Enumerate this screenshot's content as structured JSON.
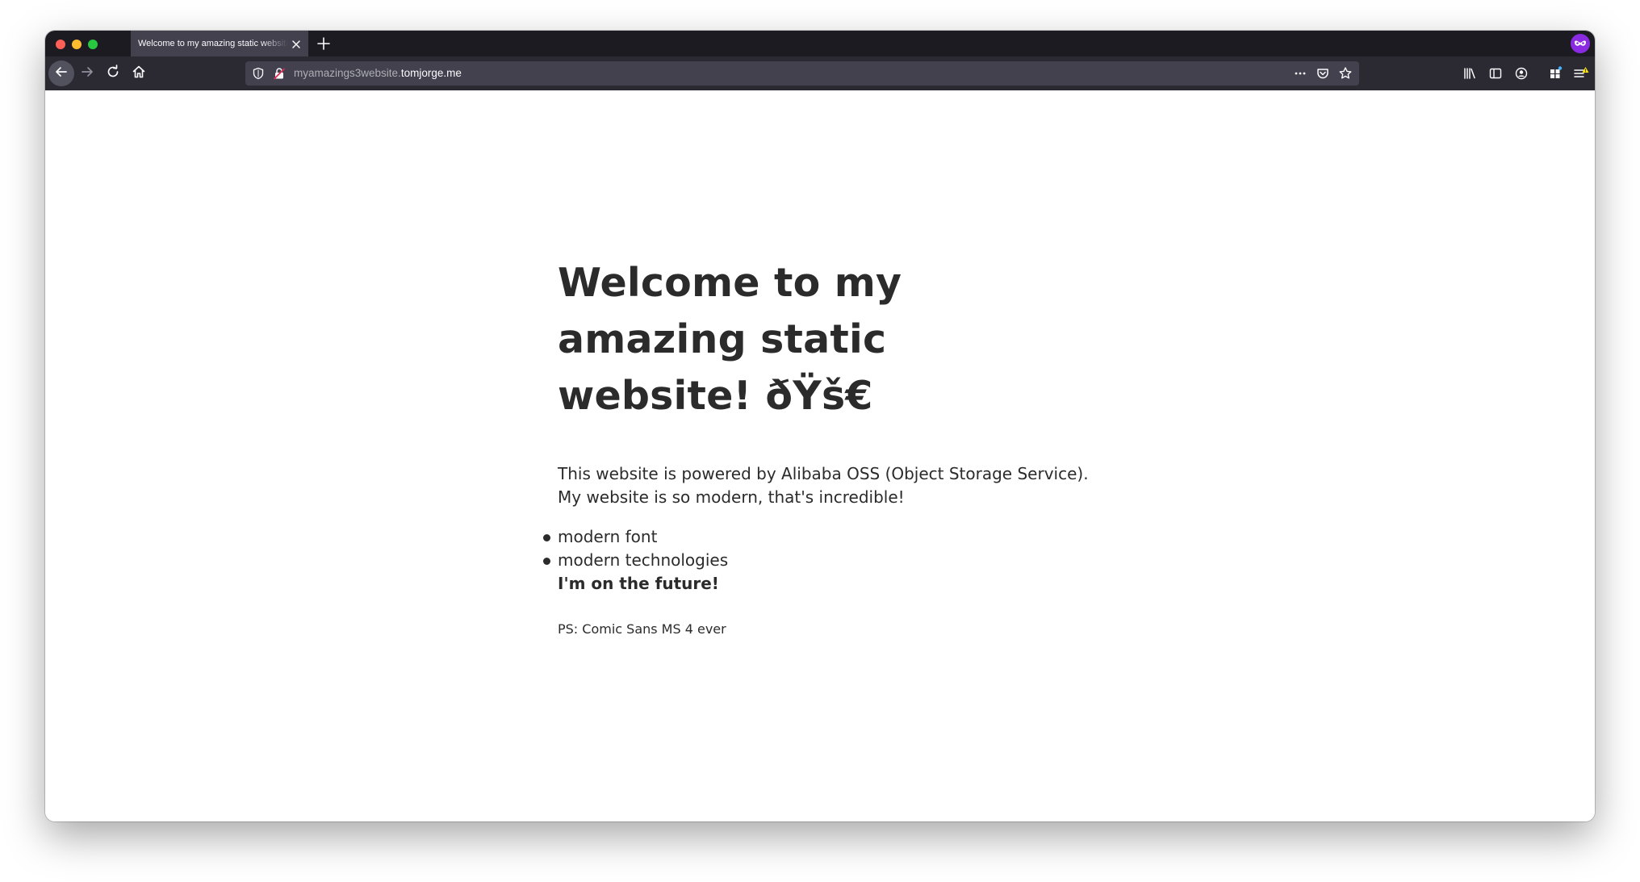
{
  "browser": {
    "tab_title": "Welcome to my amazing static website",
    "url_subdomain": "myamazings3website.",
    "url_domain": "tomjorge.me"
  },
  "page": {
    "heading": "Welcome to my amazing static website! ðŸš€",
    "paragraph_line1": "This website is powered by Alibaba OSS (Object Storage Service).",
    "paragraph_line2": "My website is so modern, that's incredible!",
    "list": [
      "modern font",
      "modern technologies",
      "I'm on the future!"
    ],
    "ps": "PS: Comic Sans MS 4 ever"
  },
  "colors": {
    "titlebar": "#1c1b22",
    "tab_active": "#42414d",
    "navbar": "#2b2a33",
    "text": "#2b2b2b",
    "extension_badge": "#8a2be2"
  },
  "icons": [
    "close-icon",
    "plus-icon",
    "mask-icon",
    "back-arrow-icon",
    "forward-arrow-icon",
    "reload-icon",
    "home-icon",
    "shield-icon",
    "insecure-lock-icon",
    "more-dots-icon",
    "pocket-icon",
    "star-icon",
    "library-icon",
    "sidebar-icon",
    "account-icon",
    "extensions-icon",
    "menu-icon"
  ]
}
